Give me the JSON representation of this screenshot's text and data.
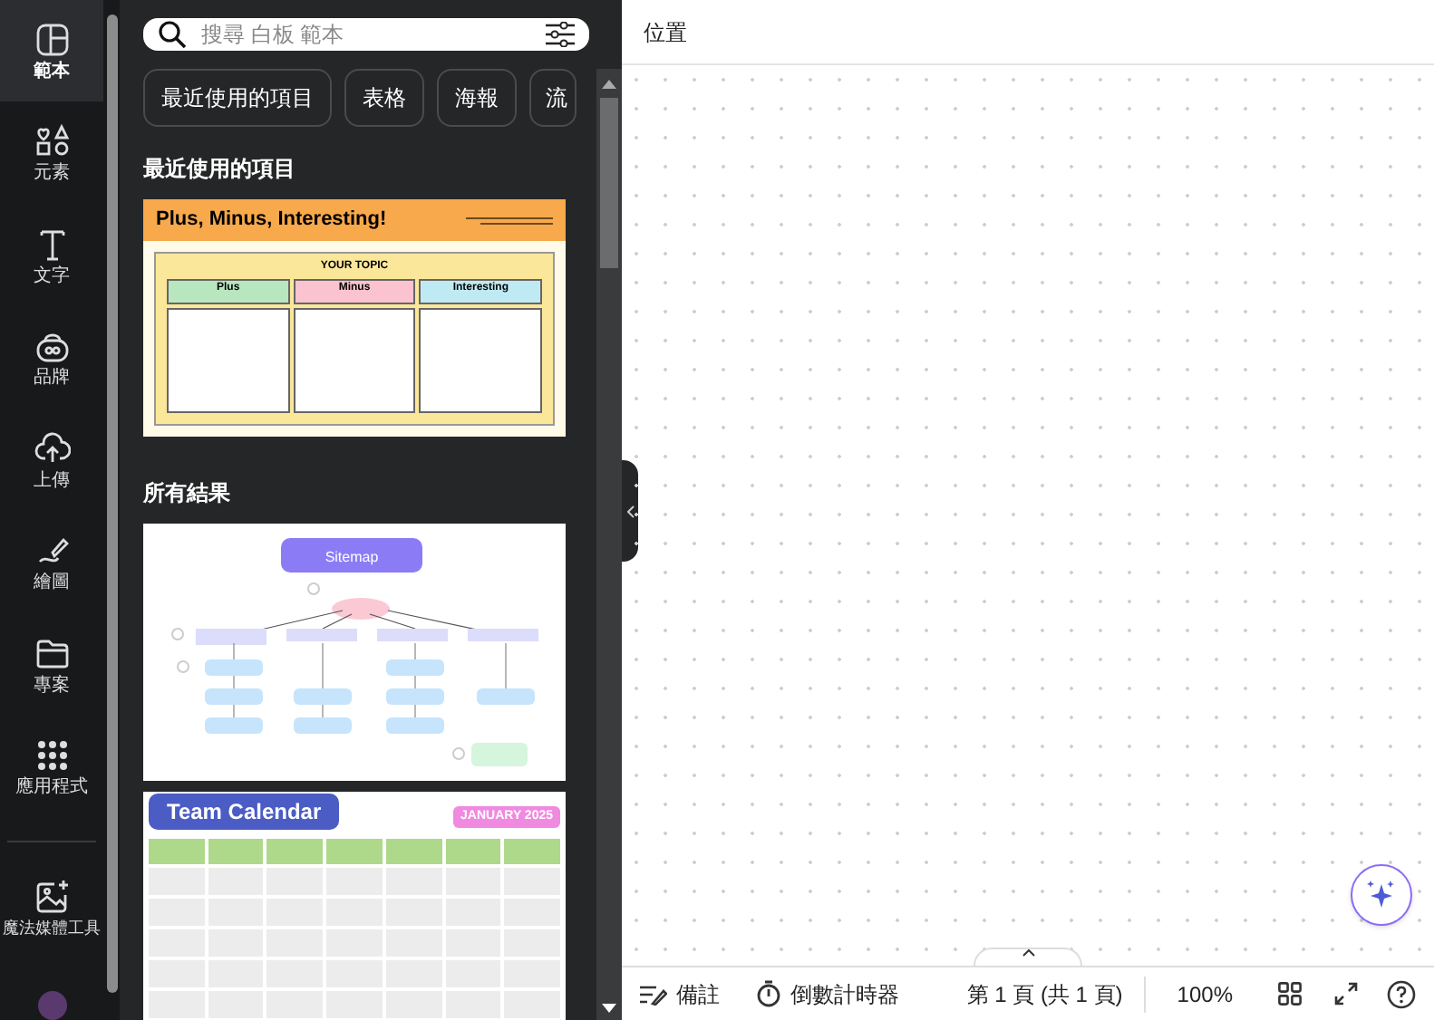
{
  "rail": {
    "items": [
      {
        "label": "範本",
        "selected": true
      },
      {
        "label": "元素",
        "selected": false
      },
      {
        "label": "文字",
        "selected": false
      },
      {
        "label": "品牌",
        "selected": false
      },
      {
        "label": "上傳",
        "selected": false
      },
      {
        "label": "繪圖",
        "selected": false
      },
      {
        "label": "專案",
        "selected": false
      },
      {
        "label": "應用程式",
        "selected": false
      }
    ],
    "extra": {
      "label": "魔法媒體工具"
    }
  },
  "panel": {
    "search": {
      "placeholder": "搜尋 白板 範本"
    },
    "chips": [
      {
        "label": "最近使用的項目"
      },
      {
        "label": "表格"
      },
      {
        "label": "海報"
      },
      {
        "label": "流"
      }
    ],
    "recent": {
      "heading": "最近使用的項目",
      "template": {
        "title": "Plus, Minus, Interesting!",
        "topic": "YOUR TOPIC",
        "columns": [
          "Plus",
          "Minus",
          "Interesting"
        ]
      }
    },
    "results": {
      "heading": "所有結果",
      "sitemap": {
        "title": "Sitemap"
      },
      "calendar": {
        "title": "Team Calendar",
        "month": "JANUARY 2025"
      }
    }
  },
  "canvas": {
    "location": "位置"
  },
  "footer": {
    "notes": "備註",
    "timer": "倒數計時器",
    "page": "第 1 頁 (共 1 頁)",
    "zoom": "100%"
  }
}
